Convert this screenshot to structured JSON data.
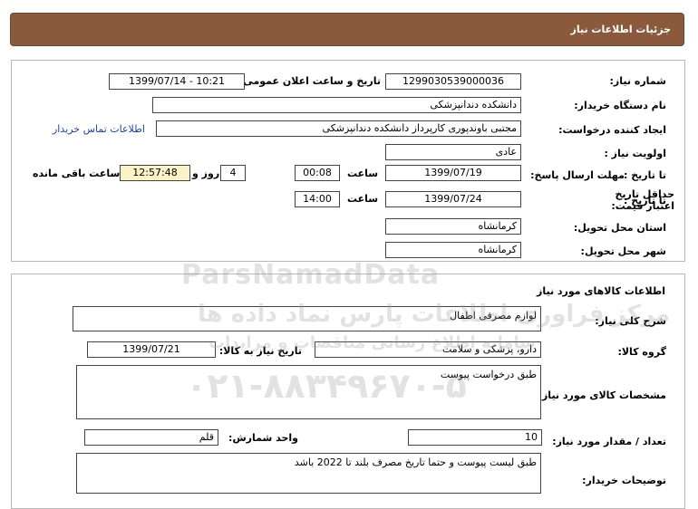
{
  "header": {
    "title": "جزئیات اطلاعات نیاز"
  },
  "need_info": {
    "need_number_label": "شماره نیاز:",
    "need_number": "1299030539000036",
    "announce_label": "تاریخ و ساعت اعلان عمومی:",
    "announce_value": "1399/07/14 - 10:21",
    "buyer_label": "نام دستگاه خریدار:",
    "buyer_value": "دانشکده دندانپزشکی",
    "creator_label": "ایجاد کننده درخواست:",
    "creator_value": "مجتبی  باوندپوری کارپرداز دانشکده دندانپزشکی",
    "contact_link": "اطلاعات تماس خریدار",
    "priority_label": "اولویت نیاز :",
    "priority_value": "عادی",
    "deadline_label": "مهلت ارسال پاسخ:",
    "to_date_label": "تا تاریخ :",
    "deadline_date": "1399/07/19",
    "time_label": "ساعت",
    "deadline_time": "00:08",
    "days_value": "4",
    "days_label": "روز و",
    "remaining_time": "12:57:48",
    "remaining_label": "ساعت باقی مانده",
    "validity_label": "حداقل تاریخ اعتبار قیمت:",
    "validity_to_label": "تا تاریخ :",
    "validity_date": "1399/07/24",
    "validity_time_label": "ساعت",
    "validity_time": "14:00",
    "province_label": "استان محل تحویل:",
    "province_value": "کرمانشاه",
    "city_label": "شهر محل تحویل:",
    "city_value": "کرمانشاه"
  },
  "goods": {
    "section_title": "اطلاعات کالاهای مورد نیاز",
    "general_desc_label": "شرح کلی نیاز:",
    "general_desc_value": "لوازم مصرفی اطفال",
    "group_label": "گروه کالا:",
    "group_value": "دارو، پزشکی و سلامت",
    "need_date_label": "تاریخ نیاز به کالا:",
    "need_date_value": "1399/07/21",
    "specs_label": "مشخصات کالای مورد نیاز:",
    "specs_value": "طبق درخواست پیوست",
    "qty_label": "تعداد / مقدار مورد نیاز:",
    "qty_value": "10",
    "unit_label": "واحد شمارش:",
    "unit_value": "قلم",
    "buyer_notes_label": "توضیحات خریدار:",
    "buyer_notes_value": "طبق لیست پیوست و حتما تاریخ مصرف بلند تا 2022 باشد"
  },
  "watermark": {
    "brand": "ParsNamadData",
    "persian": "مرکز فراوری اطلاعات پارس نماد داده ها",
    "sub": "سامانه اطلاع رسانی مناقصات و مزایدات",
    "phone": "۰۲۱-۸۸۳۴۹۶۷۰-۵"
  }
}
